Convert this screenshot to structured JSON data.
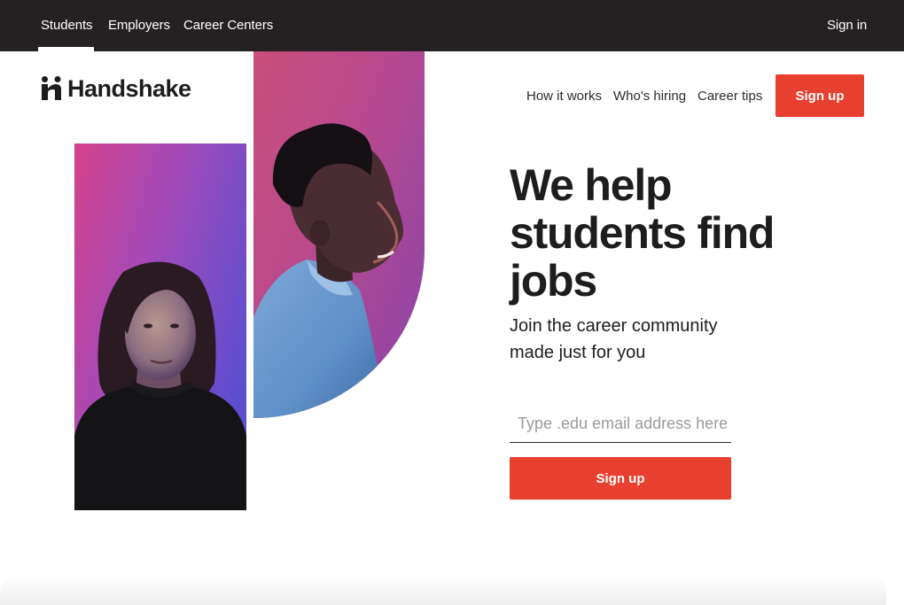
{
  "topbar": {
    "tabs": [
      {
        "label": "Students",
        "active": true
      },
      {
        "label": "Employers",
        "active": false
      },
      {
        "label": "Career Centers",
        "active": false
      }
    ],
    "sign_in": "Sign in"
  },
  "header": {
    "logo_text": "Handshake",
    "nav": [
      "How it works",
      "Who's hiring",
      "Career tips"
    ],
    "signup_label": "Sign up"
  },
  "hero": {
    "headline": "We help students find jobs",
    "subhead": "Join the career community made just for you",
    "email_placeholder": "Type .edu email address here",
    "signup_label": "Sign up"
  },
  "colors": {
    "topbar": "#252122",
    "accent": "#e8402f",
    "text": "#1d1d1d"
  },
  "icons": {
    "logo": "handshake-logo-icon"
  }
}
